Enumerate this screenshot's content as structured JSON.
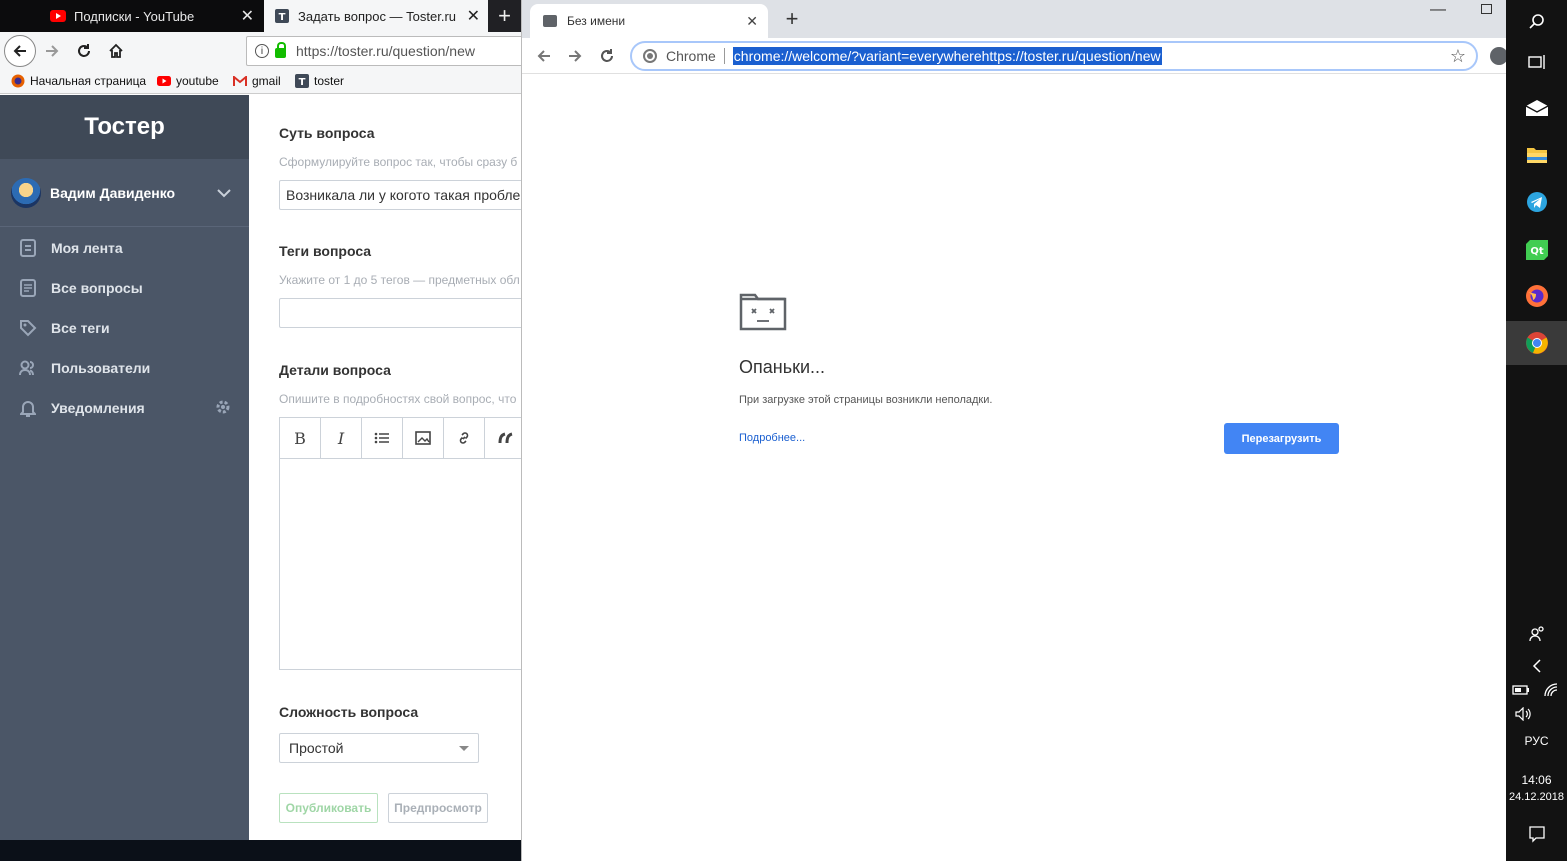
{
  "firefox": {
    "tabs": [
      {
        "title": "Подписки - YouTube",
        "active": false
      },
      {
        "title": "Задать вопрос — Toster.ru",
        "active": true
      }
    ],
    "url": "https://toster.ru/question/new",
    "bookmarks": [
      "Начальная страница",
      "youtube",
      "gmail",
      "toster"
    ]
  },
  "site": {
    "logo": "Тостер",
    "user_name": "Вадим Давиденко",
    "menu": [
      "Моя лента",
      "Все вопросы",
      "Все теги",
      "Пользователи",
      "Уведомления"
    ],
    "form": {
      "essence_label": "Суть вопроса",
      "essence_hint": "Сформулируйте вопрос так, чтобы сразу б",
      "essence_value": "Возникала ли у когото такая пробле",
      "tags_label": "Теги вопроса",
      "tags_hint": "Укажите от 1 до 5 тегов — предметных обл",
      "tags_value": "",
      "details_label": "Детали вопроса",
      "details_hint": "Опишите в подробностях свой вопрос, что",
      "toolbar": [
        "B",
        "I",
        "list-icon",
        "image-icon",
        "link-icon",
        "quote-icon"
      ],
      "difficulty_label": "Сложность вопроса",
      "difficulty_value": "Простой",
      "publish_label": "Опубликовать",
      "preview_label": "Предпросмотр"
    }
  },
  "chrome": {
    "tab_title": "Без имени",
    "omnibox_chip": "Chrome",
    "omnibox_text": "chrome://welcome/?variant=everywherehttps://toster.ru/question/new",
    "error_title": "Опаньки...",
    "error_text": "При загрузке этой страницы возникли неполадки.",
    "more_link": "Подробнее...",
    "reload_label": "Перезагрузить"
  },
  "taskbar": {
    "lang": "РУС",
    "time": "14:06",
    "date": "24.12.2018",
    "apps": [
      "search-icon",
      "task-view-icon",
      "mail-icon",
      "explorer-icon",
      "telegram-icon",
      "qt-icon",
      "firefox-icon",
      "chrome-icon"
    ],
    "active_app": "chrome-icon"
  }
}
